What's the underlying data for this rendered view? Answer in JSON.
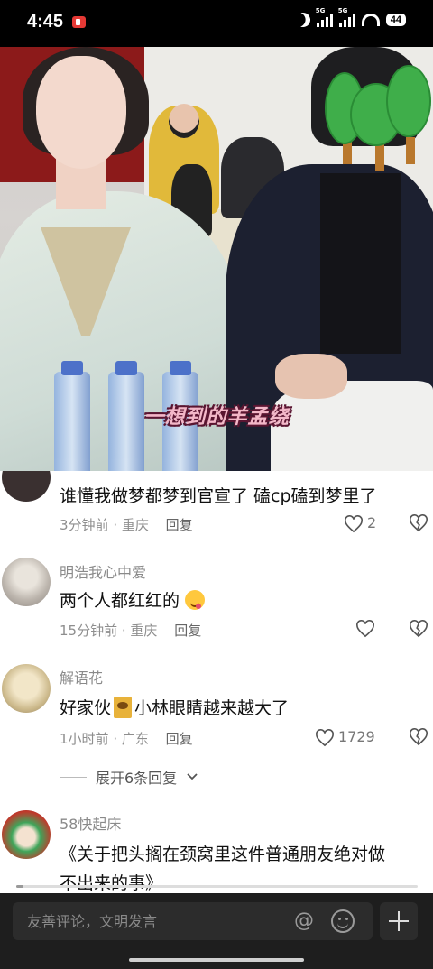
{
  "status_bar": {
    "time": "4:45",
    "signal1_label": "5G",
    "signal2_label": "5G",
    "battery": "44"
  },
  "video": {
    "subtitle": "一想到的羊孟绕"
  },
  "comments": [
    {
      "username": "",
      "text": "谁懂我做梦都梦到官宣了  磕cp磕到梦里了",
      "time": "3分钟前",
      "location": "重庆",
      "reply_label": "回复",
      "likes": "2"
    },
    {
      "username": "明浩我心中爱",
      "text": "两个人都红红的",
      "emoji": "yum-face-emoji",
      "time": "15分钟前",
      "location": "重庆",
      "reply_label": "回复",
      "likes": ""
    },
    {
      "username": "解语花",
      "text_before": "好家伙",
      "text_after": "小林眼睛越来越大了",
      "sticker": "pikachu-sticker",
      "time": "1小时前",
      "location": "广东",
      "reply_label": "回复",
      "likes": "1729",
      "expand_label": "展开6条回复"
    },
    {
      "username": "58快起床",
      "text_line1": "《关于把头搁在颈窝里这件普通朋友绝对做",
      "text_line2": "不出来的事》"
    }
  ],
  "input_bar": {
    "placeholder": "友善评论，文明发言",
    "at_symbol": "@"
  },
  "colors": {
    "subtitle": "#f3b7c8",
    "sticker_green": "#3fae4a",
    "rec_red": "#e53935"
  }
}
